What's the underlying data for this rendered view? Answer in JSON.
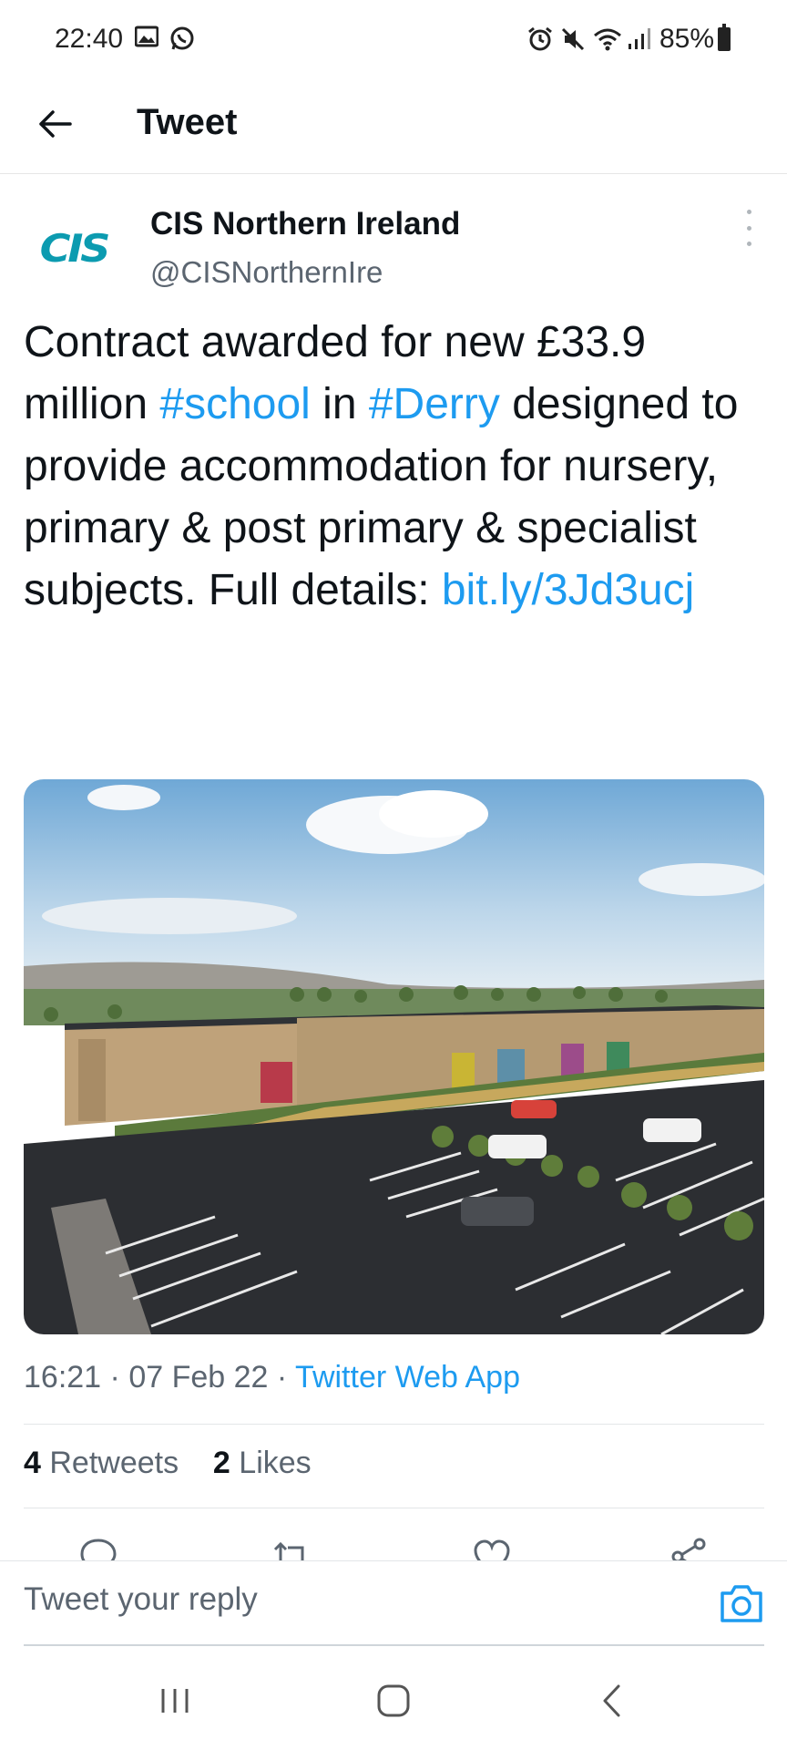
{
  "status_bar": {
    "time": "22:40",
    "left_icons": [
      "gallery-icon",
      "whatsapp-icon"
    ],
    "right_icons": [
      "alarm-icon",
      "mute-icon",
      "wifi-icon",
      "signal-icon"
    ],
    "battery": "85%"
  },
  "header": {
    "title": "Tweet",
    "back_icon": "arrow-left-icon"
  },
  "tweet": {
    "avatar_text": "CIS",
    "author_name": "CIS Northern Ireland",
    "author_handle": "@CISNorthernIre",
    "text_1": "Contract awarded for new £33.9 million ",
    "hashtag_1": "#school",
    "text_2": " in ",
    "hashtag_2": "#Derry",
    "text_3": " designed to provide accommodation for nursery, primary & post primary & specialist subjects. Full details: ",
    "link": "bit.ly/3Jd3ucj",
    "image_alt": "school building rendering with car park",
    "time": "16:21",
    "date": "07 Feb 22",
    "source": "Twitter Web App",
    "retweets_count": "4",
    "retweets_label": "Retweets",
    "likes_count": "2",
    "likes_label": "Likes"
  },
  "actions": [
    "reply-icon",
    "retweet-icon",
    "like-icon",
    "share-icon"
  ],
  "reply": {
    "placeholder": "Tweet your reply",
    "camera_icon": "camera-icon"
  },
  "nav": [
    "recents-icon",
    "home-icon",
    "back-icon"
  ],
  "colors": {
    "accent": "#1d9bf0",
    "brand_logo": "#0c9bb0",
    "text": "#0f1419",
    "secondary": "#5b6570"
  }
}
